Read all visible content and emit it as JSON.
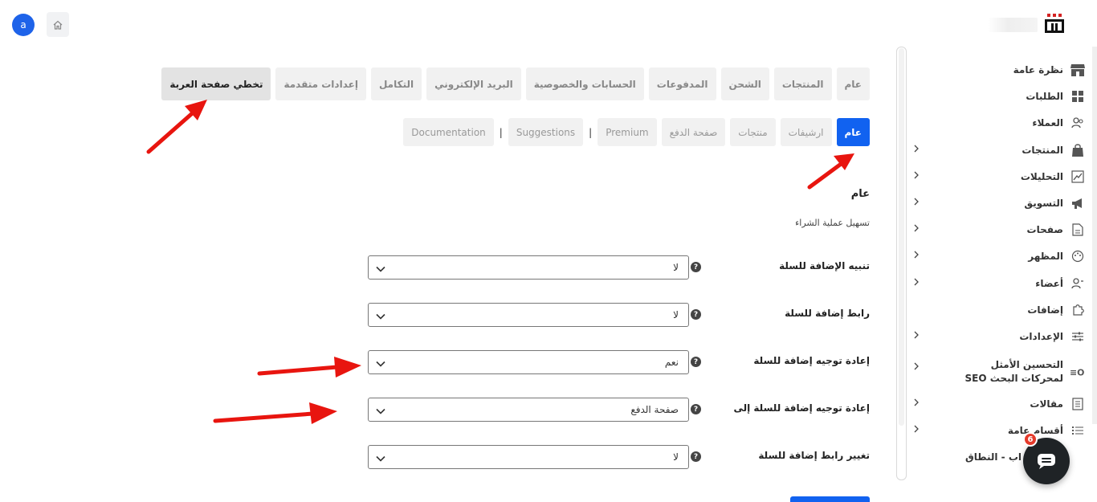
{
  "header": {
    "avatar_letter": "a",
    "brand_name_partial": "",
    "home_icon": "home-icon",
    "logo_icon": "store-logo-icon"
  },
  "sidebar": {
    "items": [
      {
        "label": "نظرة عامة",
        "icon": "store-icon",
        "has_chevron": false
      },
      {
        "label": "الطلبات",
        "icon": "grid-icon",
        "has_chevron": false
      },
      {
        "label": "العملاء",
        "icon": "users-icon",
        "has_chevron": false
      },
      {
        "label": "المنتجات",
        "icon": "bag-icon",
        "has_chevron": true
      },
      {
        "label": "التحليلات",
        "icon": "chart-icon",
        "has_chevron": true
      },
      {
        "label": "التسويق",
        "icon": "megaphone-icon",
        "has_chevron": true
      },
      {
        "label": "صفحات",
        "icon": "page-icon",
        "has_chevron": true
      },
      {
        "label": "المظهر",
        "icon": "palette-icon",
        "has_chevron": true
      },
      {
        "label": "أعضاء",
        "icon": "members-icon",
        "has_chevron": true
      },
      {
        "label": "إضافات",
        "icon": "puzzle-icon",
        "has_chevron": false
      },
      {
        "label": "الإعدادات",
        "icon": "sliders-icon",
        "has_chevron": true
      },
      {
        "label": "التحسين الأمثل لمحركات البحث SEO",
        "icon": "seo-icon",
        "has_chevron": true
      },
      {
        "label": "مقالات",
        "icon": "article-icon",
        "has_chevron": true
      },
      {
        "label": "أقسام عامة",
        "icon": "list-icon",
        "has_chevron": true
      }
    ],
    "partial_item": "اب - النطاق",
    "chat_badge": "6"
  },
  "tabs": [
    {
      "label": "عام",
      "active": false
    },
    {
      "label": "المنتجات",
      "active": false
    },
    {
      "label": "الشحن",
      "active": false
    },
    {
      "label": "المدفوعات",
      "active": false
    },
    {
      "label": "الحسابات والخصوصية",
      "active": false
    },
    {
      "label": "البريد الإلكتروني",
      "active": false
    },
    {
      "label": "التكامل",
      "active": false
    },
    {
      "label": "إعدادات متقدمة",
      "active": false
    },
    {
      "label": "تخطي صفحة العربة",
      "active": true
    }
  ],
  "subtabs": [
    {
      "label": "عام",
      "active": true
    },
    {
      "label": "ارشيفات",
      "active": false
    },
    {
      "label": "منتجات",
      "active": false
    },
    {
      "label": "صفحة الدفع",
      "active": false
    },
    {
      "label": "Premium",
      "active": false
    },
    {
      "label": "|",
      "sep": true
    },
    {
      "label": "Suggestions",
      "active": false
    },
    {
      "label": "|",
      "sep": true
    },
    {
      "label": "Documentation",
      "active": false
    }
  ],
  "section": {
    "title": "عام",
    "description": "تسهيل عملية الشراء"
  },
  "fields": [
    {
      "label": "تنبيه الإضافة للسلة",
      "value": "لا"
    },
    {
      "label": "رابط إضافة للسلة",
      "value": "لا"
    },
    {
      "label": "إعادة توجيه إضافة للسلة",
      "value": "نعم"
    },
    {
      "label": "إعادة توجيه إضافة للسلة إلى",
      "value": "صفحة الدفع"
    },
    {
      "label": "تغيير رابط إضافة للسلة",
      "value": "لا"
    }
  ],
  "help_symbol": "?",
  "colors": {
    "primary": "#1162f0",
    "annotation_arrow": "#e8150f",
    "active_tab_bg": "#e3e3e3"
  }
}
